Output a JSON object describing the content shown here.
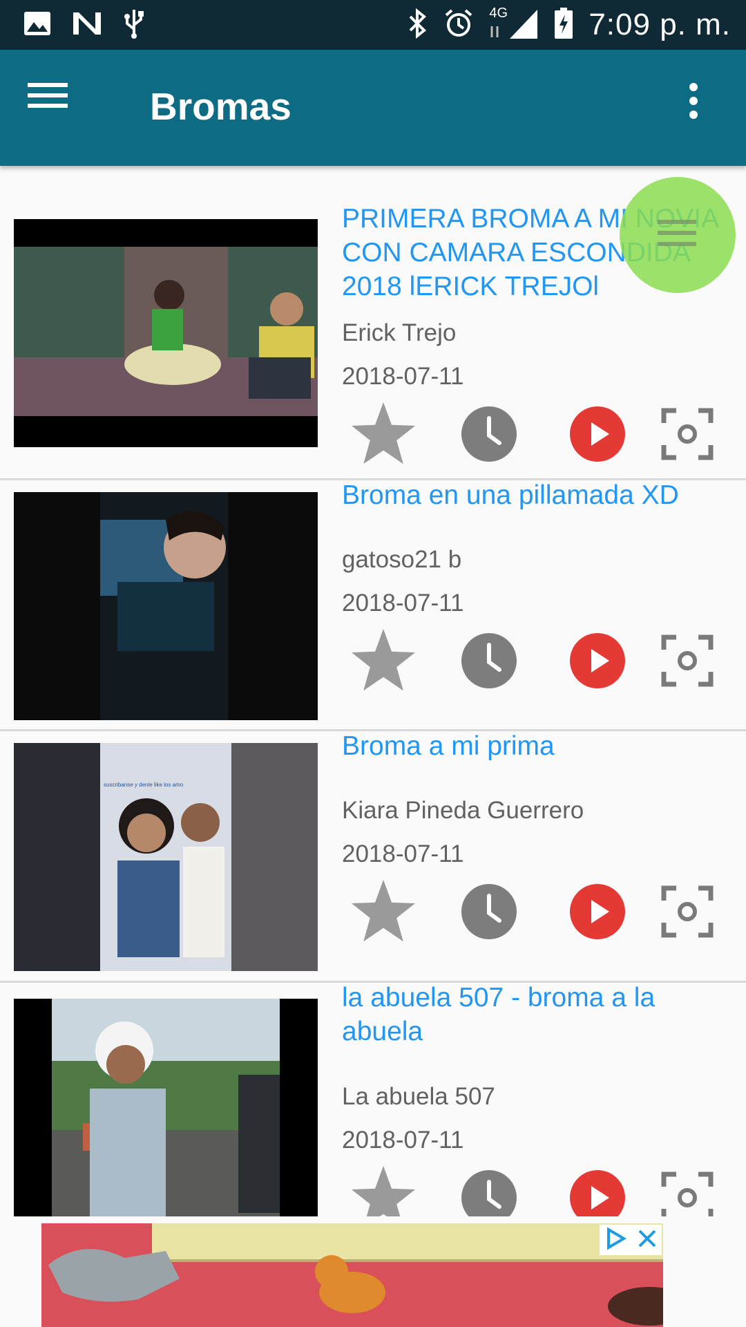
{
  "status_bar": {
    "time": "7:09 p. m.",
    "network_label": "4G",
    "icons": [
      "image-icon",
      "n-logo-icon",
      "usb-icon",
      "bluetooth-icon",
      "alarm-icon",
      "signal-icon",
      "battery-charging-icon"
    ]
  },
  "app_bar": {
    "title": "Bromas",
    "menu_icon": "hamburger-icon",
    "more_icon": "more-vert-icon",
    "color": "#0e6b84"
  },
  "videos": [
    {
      "title": "PRIMERA BROMA A MI NOVIA CON CAMARA ESCONDIDA 2018 lERICK TREJOl",
      "author": "Erick Trejo",
      "date": "2018-07-11"
    },
    {
      "title": "Broma en una pillamada XD",
      "author": "gatoso21 b",
      "date": "2018-07-11"
    },
    {
      "title": "Broma a mi prima",
      "author": "Kiara Pineda Guerrero",
      "date": "2018-07-11",
      "thumb_caption": "suscribanse y denle like los amo"
    },
    {
      "title": "la abuela 507 - broma a la abuela",
      "author": "La abuela 507",
      "date": "2018-07-11"
    }
  ],
  "actions": [
    "star-icon",
    "clock-icon",
    "play-icon",
    "screenshot-icon"
  ],
  "colors": {
    "title": "#2196f3",
    "play": "#e53935",
    "action_gray": "#8a8a8a",
    "fab": "#8bdd50"
  },
  "ad": {
    "close_icons": [
      "adchoices-icon",
      "close-icon"
    ]
  }
}
